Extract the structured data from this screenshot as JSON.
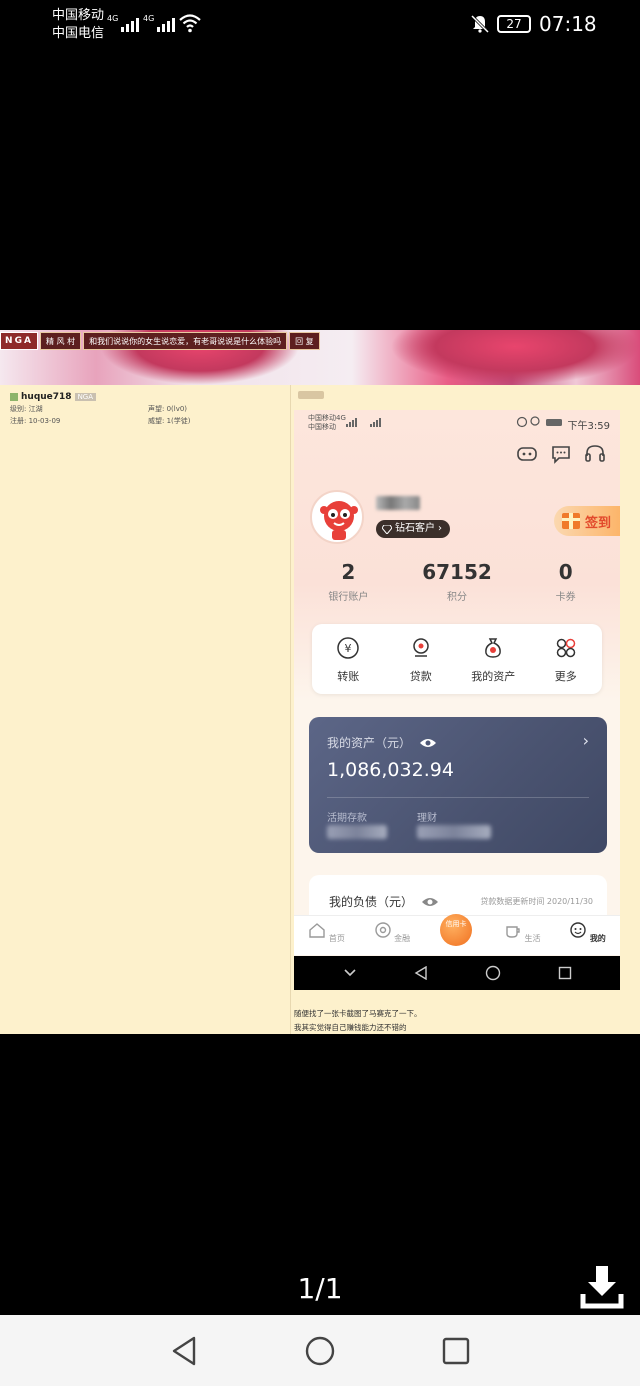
{
  "status_bar": {
    "carrier_1": "中国移动",
    "carrier_2": "中国电信",
    "net_1": "4G",
    "net_2": "4G",
    "battery": "27",
    "time": "07:18"
  },
  "forum": {
    "logo": "NGA",
    "nav": [
      "精 风 村",
      "和我们说说你的女生说恋爱，有老哥说说是什么体验吗",
      "回 复"
    ],
    "username": "huque718",
    "user_tag": "NGA",
    "stats": {
      "level": "级别: 江湖",
      "prestige": "声望: 0(lv0)",
      "registered": "注册: 10-03-09",
      "gold": "威望: 1(学徒)"
    },
    "comment_lines": [
      "随便找了一张卡截图了马赛克了一下。",
      "我其实觉得自己赚钱能力还不错的"
    ]
  },
  "inner_phone": {
    "status_left_1": "中国移动4G",
    "status_left_2": "中国移动",
    "time": "下午3:59",
    "membership": "钻石客户",
    "sign_in": "签到",
    "stats": [
      {
        "value": "2",
        "label": "银行账户"
      },
      {
        "value": "67152",
        "label": "积分"
      },
      {
        "value": "0",
        "label": "卡券"
      }
    ],
    "quick_actions": [
      "转账",
      "贷款",
      "我的资产",
      "更多"
    ],
    "assets": {
      "title": "我的资产（元）",
      "amount": "1,086,032.94",
      "sub_1": "活期存款",
      "sub_2": "理财"
    },
    "debt": {
      "title": "我的负债（元）",
      "note": "贷款数据更新时间 2020/11/30"
    },
    "tabs": [
      "首页",
      "金融",
      "信用卡",
      "生活",
      "我的"
    ],
    "center_tab": "信用卡"
  },
  "viewer": {
    "page_counter": "1/1"
  }
}
